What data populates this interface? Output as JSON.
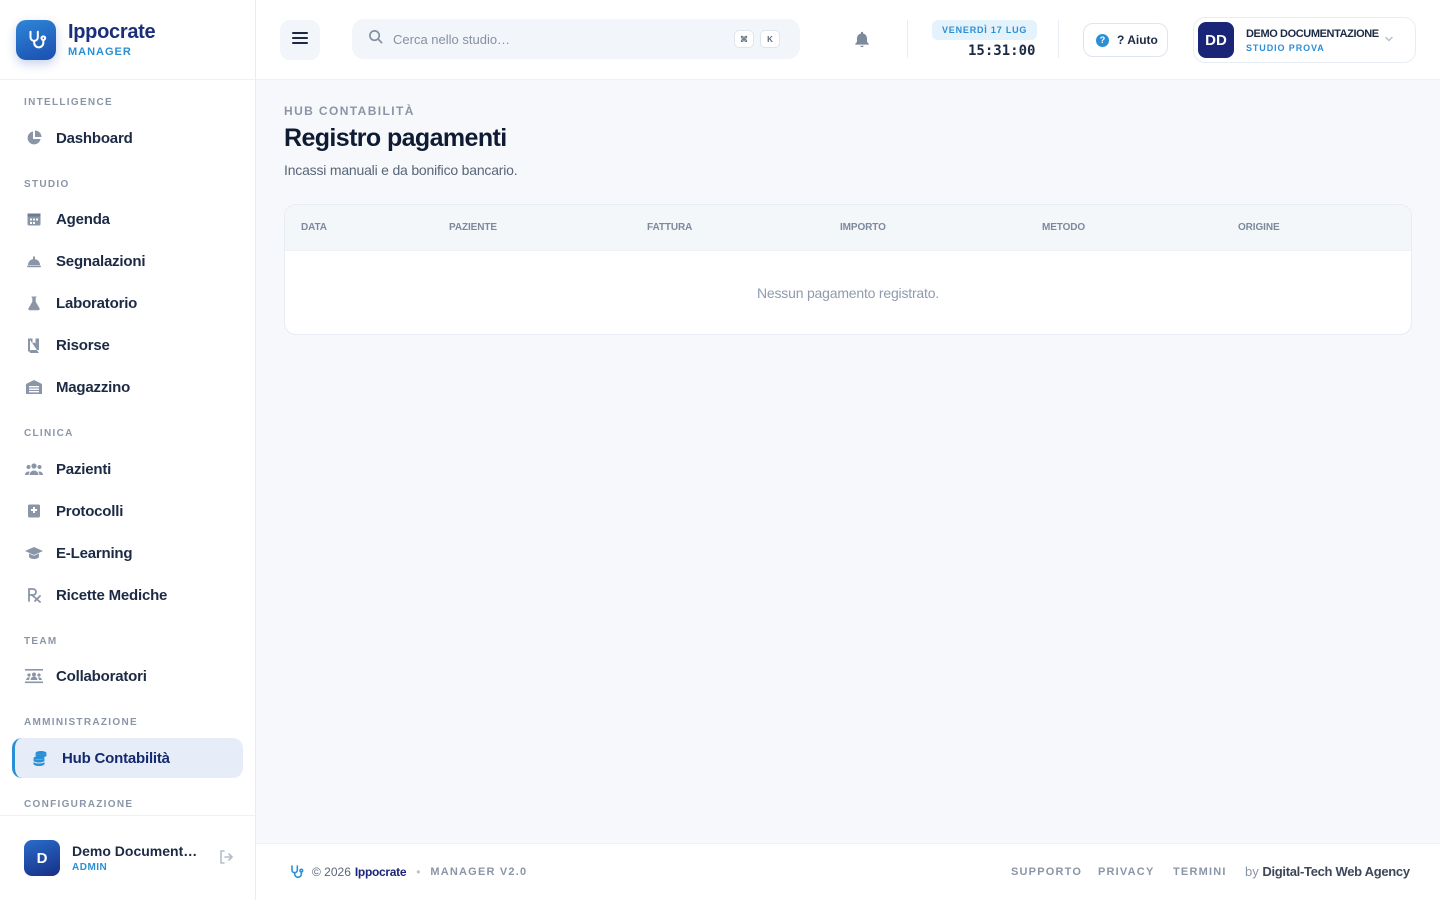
{
  "brand": {
    "name": "Ippocrate",
    "subtitle": "MANAGER"
  },
  "sidebar": {
    "sections": [
      {
        "title": "INTELLIGENCE",
        "items": [
          {
            "label": "Dashboard",
            "icon": "pie-chart-icon"
          }
        ]
      },
      {
        "title": "STUDIO",
        "items": [
          {
            "label": "Agenda",
            "icon": "calendar-icon"
          },
          {
            "label": "Segnalazioni",
            "icon": "bell-service-icon"
          },
          {
            "label": "Laboratorio",
            "icon": "flask-icon"
          },
          {
            "label": "Risorse",
            "icon": "bookmark-book-icon"
          },
          {
            "label": "Magazzino",
            "icon": "warehouse-icon"
          }
        ]
      },
      {
        "title": "CLINICA",
        "items": [
          {
            "label": "Pazienti",
            "icon": "users-icon"
          },
          {
            "label": "Protocolli",
            "icon": "medical-book-icon"
          },
          {
            "label": "E-Learning",
            "icon": "graduation-cap-icon"
          },
          {
            "label": "Ricette Mediche",
            "icon": "prescription-icon"
          }
        ]
      },
      {
        "title": "TEAM",
        "items": [
          {
            "label": "Collaboratori",
            "icon": "users-list-icon"
          }
        ]
      },
      {
        "title": "AMMINISTRAZIONE",
        "items": [
          {
            "label": "Hub Contabilità",
            "icon": "coins-icon",
            "active": true
          }
        ]
      },
      {
        "title": "CONFIGURAZIONE",
        "items": []
      }
    ],
    "user": {
      "initial": "D",
      "name": "Demo Documentazione",
      "role": "ADMIN"
    }
  },
  "header": {
    "search_placeholder": "Cerca nello studio…",
    "shortcut_keys": [
      "⌘",
      "K"
    ],
    "date": "VENERDÌ 17 LUG",
    "time": "15:31:00",
    "help_label": "? Aiuto",
    "profile": {
      "initials": "DD",
      "name": "DEMO DOCUMENTAZIONE",
      "subtitle": "STUDIO PROVA"
    }
  },
  "main": {
    "kicker": "HUB CONTABILITÀ",
    "title": "Registro pagamenti",
    "subtitle": "Incassi manuali e da bonifico bancario.",
    "table": {
      "columns": [
        "DATA",
        "PAZIENTE",
        "FATTURA",
        "IMPORTO",
        "METODO",
        "ORIGINE"
      ],
      "rows": [],
      "empty_message": "Nessun pagamento registrato."
    }
  },
  "footer": {
    "copyright": "© 2026",
    "brand": "Ippocrate",
    "version": "MANAGER V2.0",
    "links": [
      "SUPPORTO",
      "PRIVACY",
      "TERMINI"
    ],
    "by_prefix": "by",
    "agency": "Digital-Tech Web Agency"
  },
  "colors": {
    "accent": "#2b8fd6",
    "brand_dark": "#1a2578",
    "active_bg": "#e6edf8"
  }
}
